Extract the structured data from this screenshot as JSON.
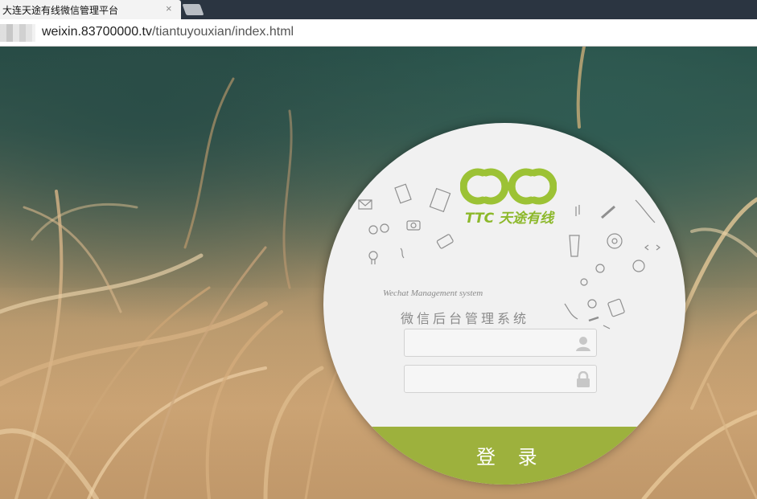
{
  "browser": {
    "tab_title": "大连天途有线微信管理平台",
    "close_symbol": "×",
    "url_host": "weixin.83700000.tv",
    "url_path": "/tiantuyouxian/index.html"
  },
  "login": {
    "brand_text": "TTC 天途有线",
    "subtitle_en": "Wechat Management system",
    "subtitle_cn": "微信后台管理系统",
    "username_value": "",
    "password_value": "",
    "submit_label": "登 录"
  },
  "colors": {
    "accent_green": "#9db13d",
    "logo_green": "#8cb82a"
  },
  "icons": [
    "user-icon",
    "lock-icon",
    "logo-icon"
  ]
}
